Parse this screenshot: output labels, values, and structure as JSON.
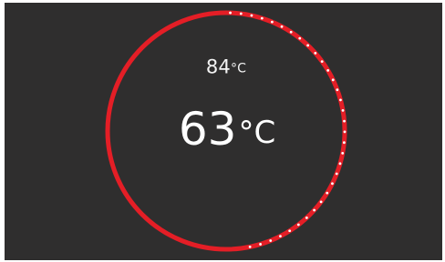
{
  "thermostat": {
    "target": {
      "value": "84",
      "unit": "°C"
    },
    "current": {
      "value": "63",
      "unit": "°C"
    },
    "progress_fraction": 0.47
  },
  "colors": {
    "background": "#2f2e2e",
    "ring": "#e41e26",
    "ticks": "#ffffff",
    "text": "#ffffff"
  }
}
